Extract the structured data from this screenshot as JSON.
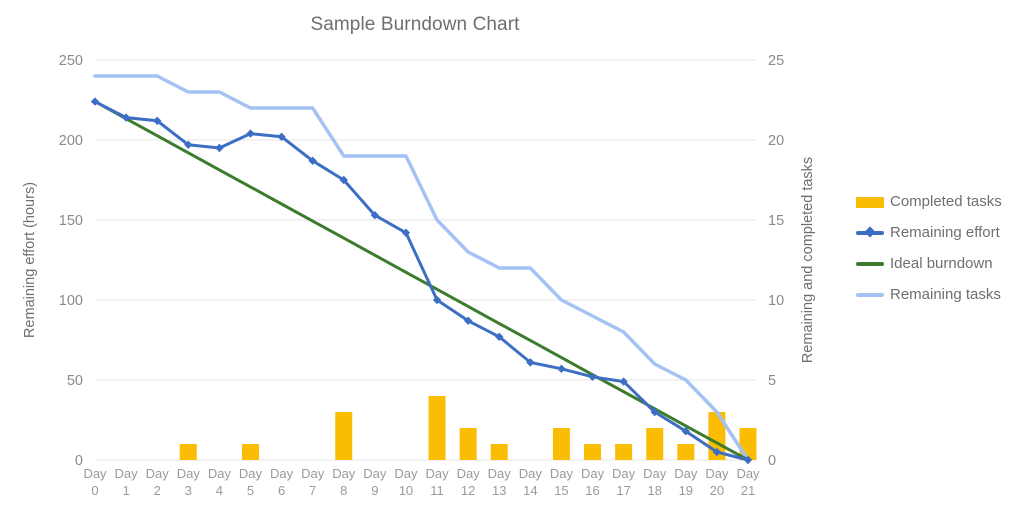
{
  "chart_data": {
    "type": "bar",
    "title": "Sample Burndown Chart",
    "xlabel": "",
    "ylabel": "Remaining effort (hours)",
    "y2label": "Remaining and completed tasks",
    "grid": true,
    "legend_position": "right",
    "ylim": [
      0,
      250
    ],
    "y2lim": [
      0,
      25
    ],
    "yticks": [
      "0",
      "50",
      "100",
      "150",
      "200",
      "250"
    ],
    "y2ticks": [
      "0",
      "5",
      "10",
      "15",
      "20",
      "25"
    ],
    "categories": [
      "Day 0",
      "Day 1",
      "Day 2",
      "Day 3",
      "Day 4",
      "Day 5",
      "Day 6",
      "Day 7",
      "Day 8",
      "Day 9",
      "Day 10",
      "Day 11",
      "Day 12",
      "Day 13",
      "Day 14",
      "Day 15",
      "Day 16",
      "Day 17",
      "Day 18",
      "Day 19",
      "Day 20",
      "Day 21"
    ],
    "series": [
      {
        "name": "Completed tasks",
        "type": "bar",
        "axis": "right",
        "color": "#FBBC04",
        "values": [
          0,
          0,
          0,
          1,
          0,
          1,
          0,
          0,
          3,
          0,
          0,
          4,
          2,
          1,
          0,
          2,
          1,
          1,
          2,
          1,
          3,
          2
        ]
      },
      {
        "name": "Remaining effort",
        "type": "line",
        "axis": "left",
        "color": "#3C6FC4",
        "marker": "diamond",
        "values": [
          224,
          214,
          212,
          197,
          195,
          204,
          202,
          187,
          175,
          153,
          142,
          100,
          87,
          77,
          61,
          57,
          52,
          49,
          30,
          18,
          5,
          0
        ]
      },
      {
        "name": "Ideal burndown",
        "type": "line",
        "axis": "left",
        "color": "#3D7B2F",
        "marker": "none",
        "values": [
          224,
          213.3,
          202.7,
          192,
          181.3,
          170.7,
          160,
          149.3,
          138.7,
          128,
          117.3,
          106.7,
          96,
          85.3,
          74.7,
          64,
          53.3,
          42.7,
          32,
          21.3,
          10.7,
          0
        ]
      },
      {
        "name": "Remaining tasks",
        "type": "line",
        "axis": "right",
        "color": "#A4C2F4",
        "marker": "none",
        "values": [
          24,
          24,
          24,
          23,
          23,
          22,
          22,
          22,
          19,
          19,
          19,
          15,
          13,
          12,
          12,
          10,
          9,
          8,
          6,
          5,
          3,
          0
        ]
      }
    ]
  },
  "legend": {
    "items": [
      {
        "label": "Completed tasks",
        "key": "bar",
        "color": "#FBBC04"
      },
      {
        "label": "Remaining effort",
        "key": "line-marker",
        "color": "#3C6FC4"
      },
      {
        "label": "Ideal burndown",
        "key": "line",
        "color": "#3D7B2F"
      },
      {
        "label": "Remaining tasks",
        "key": "line",
        "color": "#A4C2F4"
      }
    ]
  }
}
